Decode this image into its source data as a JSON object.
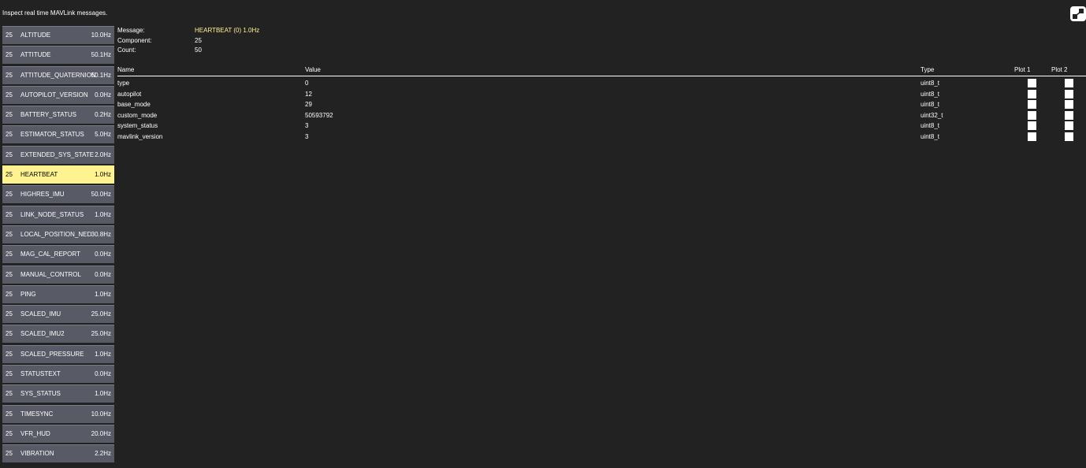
{
  "header": {
    "description": "Inspect real time MAVLink messages."
  },
  "messages": [
    {
      "comp": "25",
      "name": "ALTITUDE",
      "rate": "10.0Hz"
    },
    {
      "comp": "25",
      "name": "ATTITUDE",
      "rate": "50.1Hz"
    },
    {
      "comp": "25",
      "name": "ATTITUDE_QUATERNION",
      "rate": "50.1Hz"
    },
    {
      "comp": "25",
      "name": "AUTOPILOT_VERSION",
      "rate": "0.0Hz"
    },
    {
      "comp": "25",
      "name": "BATTERY_STATUS",
      "rate": "0.2Hz"
    },
    {
      "comp": "25",
      "name": "ESTIMATOR_STATUS",
      "rate": "5.0Hz"
    },
    {
      "comp": "25",
      "name": "EXTENDED_SYS_STATE",
      "rate": "2.0Hz"
    },
    {
      "comp": "25",
      "name": "HEARTBEAT",
      "rate": "1.0Hz",
      "selected": true
    },
    {
      "comp": "25",
      "name": "HIGHRES_IMU",
      "rate": "50.0Hz"
    },
    {
      "comp": "25",
      "name": "LINK_NODE_STATUS",
      "rate": "1.0Hz"
    },
    {
      "comp": "25",
      "name": "LOCAL_POSITION_NED",
      "rate": "30.8Hz"
    },
    {
      "comp": "25",
      "name": "MAG_CAL_REPORT",
      "rate": "0.0Hz"
    },
    {
      "comp": "25",
      "name": "MANUAL_CONTROL",
      "rate": "0.0Hz"
    },
    {
      "comp": "25",
      "name": "PING",
      "rate": "1.0Hz"
    },
    {
      "comp": "25",
      "name": "SCALED_IMU",
      "rate": "25.0Hz"
    },
    {
      "comp": "25",
      "name": "SCALED_IMU2",
      "rate": "25.0Hz"
    },
    {
      "comp": "25",
      "name": "SCALED_PRESSURE",
      "rate": "1.0Hz"
    },
    {
      "comp": "25",
      "name": "STATUSTEXT",
      "rate": "0.0Hz"
    },
    {
      "comp": "25",
      "name": "SYS_STATUS",
      "rate": "1.0Hz"
    },
    {
      "comp": "25",
      "name": "TIMESYNC",
      "rate": "10.0Hz"
    },
    {
      "comp": "25",
      "name": "VFR_HUD",
      "rate": "20.0Hz"
    },
    {
      "comp": "25",
      "name": "VIBRATION",
      "rate": "2.2Hz"
    }
  ],
  "info": {
    "message_label": "Message:",
    "message_value": "HEARTBEAT (0) 1.0Hz",
    "component_label": "Component:",
    "component_value": "25",
    "count_label": "Count:",
    "count_value": "50"
  },
  "table": {
    "headers": {
      "name": "Name",
      "value": "Value",
      "type": "Type",
      "plot1": "Plot 1",
      "plot2": "Plot 2"
    },
    "rows": [
      {
        "name": "type",
        "value": "0",
        "type": "uint8_t",
        "plot1": false,
        "plot2": false
      },
      {
        "name": "autopilot",
        "value": "12",
        "type": "uint8_t",
        "plot1": false,
        "plot2": false
      },
      {
        "name": "base_mode",
        "value": "29",
        "type": "uint8_t",
        "plot1": false,
        "plot2": false
      },
      {
        "name": "custom_mode",
        "value": "50593792",
        "type": "uint32_t",
        "plot1": false,
        "plot2": false
      },
      {
        "name": "system_status",
        "value": "3",
        "type": "uint8_t",
        "plot1": false,
        "plot2": false
      },
      {
        "name": "mavlink_version",
        "value": "3",
        "type": "uint8_t",
        "plot1": false,
        "plot2": false
      }
    ]
  },
  "icons": {
    "expand": "expand-icon"
  },
  "colors": {
    "background": "#222222",
    "list_item": "#585a66",
    "selected": "#fff291",
    "accent_text": "#fff291"
  }
}
